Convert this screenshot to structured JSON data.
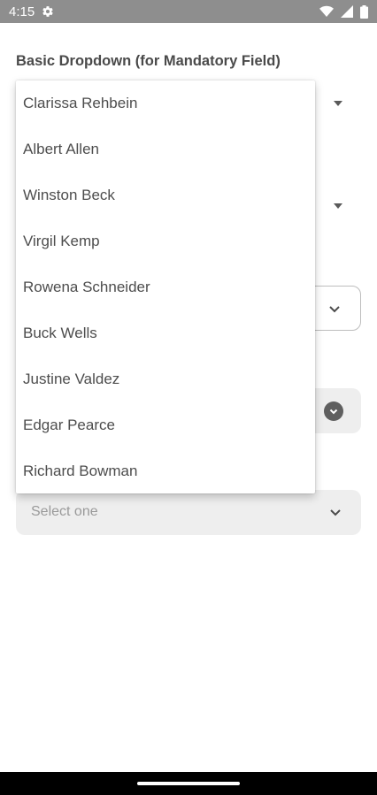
{
  "status_bar": {
    "time": "4:15",
    "icons": [
      "gear-icon",
      "wifi-icon",
      "signal-icon",
      "battery-icon"
    ]
  },
  "section": {
    "title": "Basic Dropdown (for Mandatory Field)"
  },
  "menu": {
    "items": [
      "Clarissa Rehbein",
      "Albert Allen",
      "Winston Beck",
      "Virgil Kemp",
      "Rowena Schneider",
      "Buck Wells",
      "Justine Valdez",
      "Edgar Pearce",
      "Richard Bowman"
    ]
  },
  "select_field": {
    "placeholder": "Select one"
  },
  "colors": {
    "status_bar": "#8e8e8e",
    "filled_field": "#eeeeee",
    "text": "#4d4d4d",
    "nav_bar": "#000000"
  }
}
